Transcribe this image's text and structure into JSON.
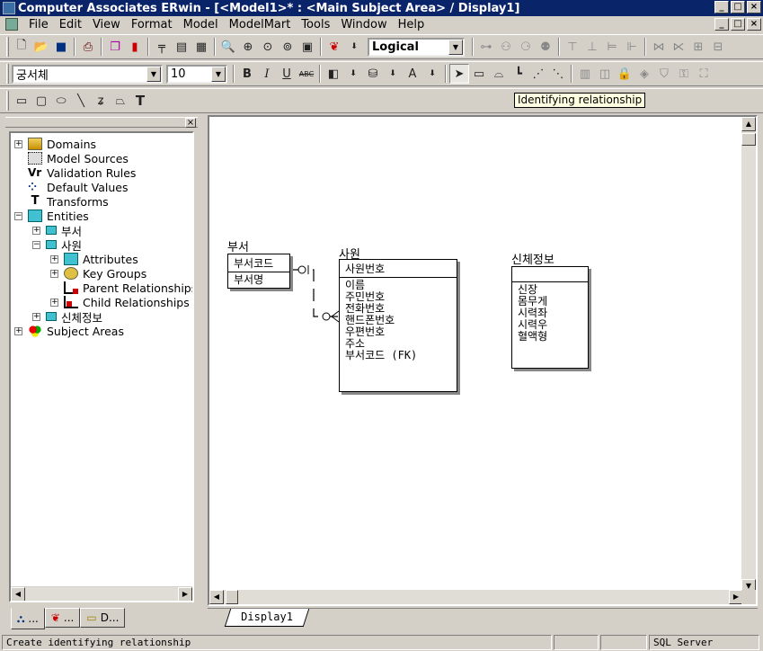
{
  "window": {
    "title": "Computer Associates ERwin - [<Model1>* : <Main Subject Area> / Display1]",
    "controls": {
      "minimize": "_",
      "maximize": "□",
      "close": "×"
    }
  },
  "menu": {
    "items": [
      "File",
      "Edit",
      "View",
      "Format",
      "Model",
      "ModelMart",
      "Tools",
      "Window",
      "Help"
    ]
  },
  "toolbar1": {
    "view_mode": "Logical"
  },
  "toolbar2": {
    "font_name": "궁서체",
    "font_size": "10",
    "bold": "B",
    "italic": "I",
    "underline": "U",
    "strike": "ABC"
  },
  "tooltip": "Identifying relationship",
  "tree": {
    "items": [
      {
        "label": "Domains",
        "expander": "+"
      },
      {
        "label": "Model Sources",
        "expander": ""
      },
      {
        "label": "Validation Rules",
        "expander": ""
      },
      {
        "label": "Default Values",
        "expander": ""
      },
      {
        "label": "Transforms",
        "expander": ""
      },
      {
        "label": "Entities",
        "expander": "−"
      },
      {
        "label": "부서",
        "expander": "+"
      },
      {
        "label": "사원",
        "expander": "−"
      },
      {
        "label": "Attributes",
        "expander": "+"
      },
      {
        "label": "Key Groups",
        "expander": "+"
      },
      {
        "label": "Parent Relationships",
        "expander": ""
      },
      {
        "label": "Child Relationships",
        "expander": "+"
      },
      {
        "label": "신체정보",
        "expander": "+"
      },
      {
        "label": "Subject Areas",
        "expander": "+"
      }
    ],
    "tabs": [
      "...",
      "...",
      "D..."
    ]
  },
  "entities": {
    "dept": {
      "name": "부서",
      "pk": "부서코드",
      "attrs": "부서명"
    },
    "emp": {
      "name": "사원",
      "pk": "사원번호",
      "attrs": [
        "이름",
        "주민번호",
        "전화번호",
        "핸드폰번호",
        "우편번호",
        "주소",
        "부서코드 (FK)"
      ]
    },
    "body": {
      "name": "신체정보",
      "pk": "",
      "attrs": [
        "신장",
        "몸무게",
        "시력좌",
        "시력우",
        "혈액형"
      ]
    }
  },
  "sheet_tab": "Display1",
  "status": {
    "message": "Create identifying relationship",
    "db": "SQL Server"
  }
}
